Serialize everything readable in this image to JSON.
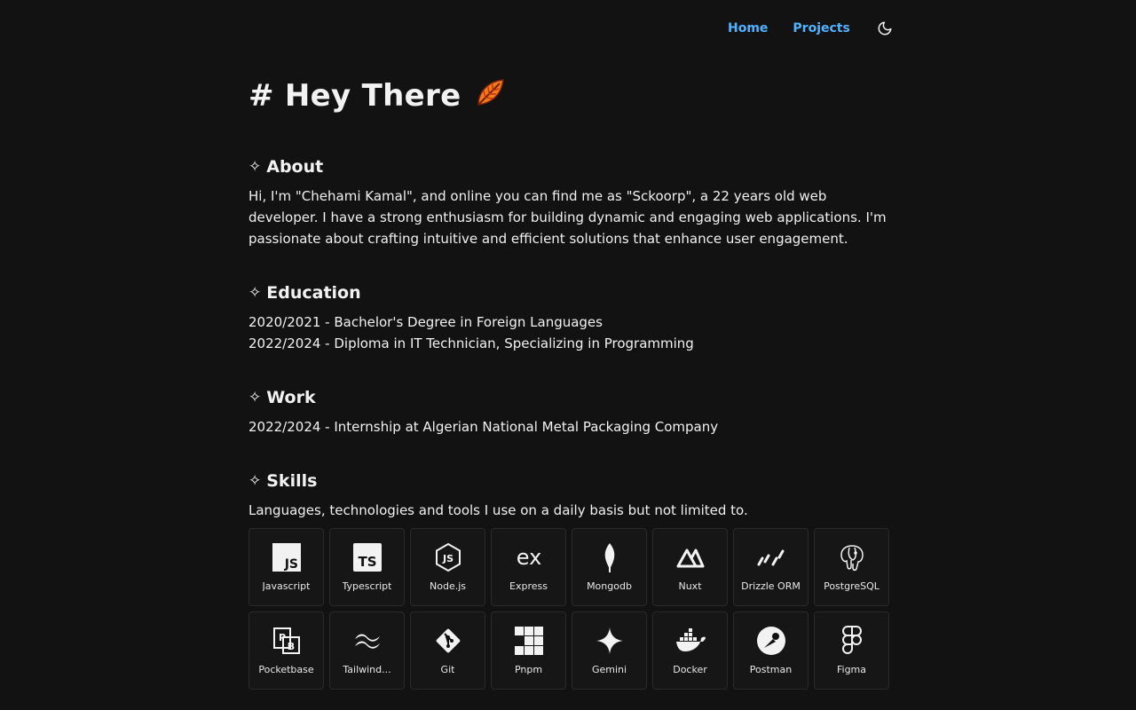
{
  "nav": {
    "home": "Home",
    "projects": "Projects"
  },
  "heading": {
    "title": "# Hey There"
  },
  "about": {
    "title": "About",
    "text": "Hi, I'm \"Chehami Kamal\", and online you can find me as \"Sckoorp\", a 22 years old web developer. I have a strong enthusiasm for building dynamic and engaging web applications. I'm passionate about crafting intuitive and efficient solutions that enhance user engagement."
  },
  "education": {
    "title": "Education",
    "items": [
      "2020/2021 - Bachelor's Degree in Foreign Languages",
      "2022/2024 - Diploma in IT Technician, Specializing in Programming"
    ]
  },
  "work": {
    "title": "Work",
    "items": [
      "2022/2024 - Internship at Algerian National Metal Packaging Company"
    ]
  },
  "skills": {
    "title": "Skills",
    "intro": "Languages, technologies and tools I use on a daily basis but not limited to.",
    "items": [
      {
        "label": "Javascript",
        "icon": "javascript-icon"
      },
      {
        "label": "Typescript",
        "icon": "typescript-icon"
      },
      {
        "label": "Node.js",
        "icon": "nodejs-icon"
      },
      {
        "label": "Express",
        "icon": "express-icon"
      },
      {
        "label": "Mongodb",
        "icon": "mongodb-icon"
      },
      {
        "label": "Nuxt",
        "icon": "nuxt-icon"
      },
      {
        "label": "Drizzle ORM",
        "icon": "drizzle-icon"
      },
      {
        "label": "PostgreSQL",
        "icon": "postgresql-icon"
      },
      {
        "label": "Pocketbase",
        "icon": "pocketbase-icon"
      },
      {
        "label": "Tailwind...",
        "icon": "tailwind-icon"
      },
      {
        "label": "Git",
        "icon": "git-icon"
      },
      {
        "label": "Pnpm",
        "icon": "pnpm-icon"
      },
      {
        "label": "Gemini",
        "icon": "gemini-icon"
      },
      {
        "label": "Docker",
        "icon": "docker-icon"
      },
      {
        "label": "Postman",
        "icon": "postman-icon"
      },
      {
        "label": "Figma",
        "icon": "figma-icon"
      }
    ]
  },
  "colors": {
    "background": "#121212",
    "link": "#4fb3ff",
    "tile": "#161616",
    "tile_border": "#2a2a2a"
  }
}
